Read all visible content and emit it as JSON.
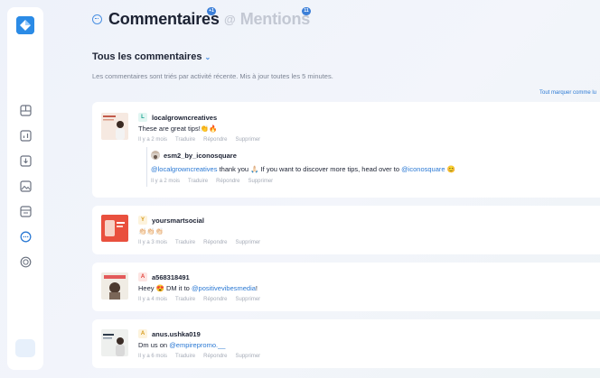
{
  "header": {
    "comments_tab": "Commentaires",
    "comments_count": "+1",
    "mentions_tab": "Mentions",
    "mentions_count": "11"
  },
  "section": {
    "title": "Tous les commentaires",
    "description": "Les commentaires sont triés par activité récente. Mis à jour toutes les 5 minutes.",
    "mark_all_read": "Tout marquer comme lu"
  },
  "actions": {
    "translate": "Traduire",
    "reply": "Répondre",
    "delete": "Supprimer"
  },
  "comments": [
    {
      "author": "localgrowncreatives",
      "initial": "L",
      "initial_color": "#17a38f",
      "initial_bg": "#e2f6f2",
      "text": "These are great tips!👏🔥",
      "time": "Il y a 2 mois",
      "reply": {
        "author": "esm2_by_iconosquare",
        "mention1": "@localgrowncreatives",
        "text_mid": " thank you 🙏🏻 If you want to discover more tips, head over to ",
        "mention2": "@iconosquare",
        "text_end": " 😊",
        "time": "Il y a 2 mois"
      }
    },
    {
      "author": "yoursmartsocial",
      "initial": "Y",
      "initial_color": "#d69a1a",
      "initial_bg": "#fdf3dd",
      "text": "👏🏻👏🏻👏🏻",
      "time": "Il y a 3 mois"
    },
    {
      "author": "a568318491",
      "initial": "A",
      "initial_color": "#e0443c",
      "initial_bg": "#fde5e3",
      "text_before": "Heey 😍 DM it to ",
      "mention": "@positivevibesmedia",
      "text_after": "!",
      "time": "Il y a 4 mois"
    },
    {
      "author": "anus.ushka019",
      "initial": "A",
      "initial_color": "#d69a1a",
      "initial_bg": "#fdf3dd",
      "text_before": "Dm us on ",
      "mention": "@empirepromo.__",
      "time": "Il y a 6 mois"
    }
  ],
  "colors": {
    "accent": "#2b79d4",
    "brand": "#2b8be6",
    "muted": "#a6acb8"
  }
}
